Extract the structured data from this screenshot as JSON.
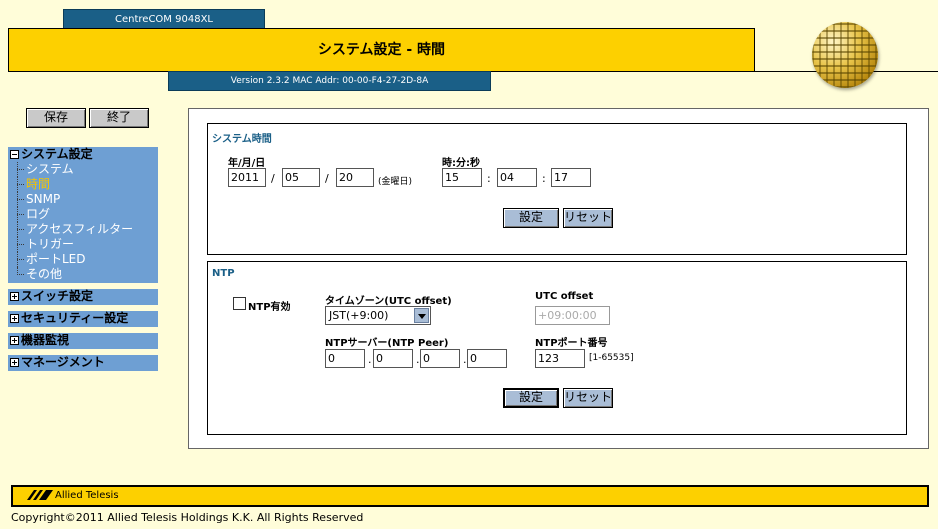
{
  "header": {
    "model": "CentreCOM 9048XL",
    "title": "システム設定 - 時間",
    "version": "Version 2.3.2 MAC Addr: 00-00-F4-27-2D-8A"
  },
  "toolbar": {
    "save_label": "保存",
    "exit_label": "終了"
  },
  "sidebar": {
    "system_group": {
      "label": "システム設定",
      "items": [
        "システム",
        "時間",
        "SNMP",
        "ログ",
        "アクセスフィルター",
        "トリガー",
        "ポートLED",
        "その他"
      ]
    },
    "switch_group": "スイッチ設定",
    "security_group": "セキュリティー設定",
    "monitor_group": "機器監視",
    "management_group": "マネージメント"
  },
  "system_time": {
    "title": "システム時間",
    "date_label": "年/月/日",
    "time_label": "時:分:秒",
    "year": "2011",
    "month": "05",
    "day": "20",
    "weekday": "(金曜日)",
    "hour": "15",
    "minute": "04",
    "second": "17",
    "date_sep": "/",
    "time_sep": ":",
    "set_label": "設定",
    "reset_label": "リセット"
  },
  "ntp": {
    "title": "NTP",
    "enable_label": "NTP有効",
    "enabled": false,
    "timezone_label": "タイムゾーン(UTC offset)",
    "timezone_value": "JST(+9:00)",
    "utc_offset_label": "UTC offset",
    "utc_offset_value": "+09:00:00",
    "server_label": "NTPサーバー(NTP Peer)",
    "server_ip": [
      "0",
      "0",
      "0",
      "0"
    ],
    "ip_sep": ".",
    "port_label": "NTPポート番号",
    "port_value": "123",
    "port_range": "[1-65535]",
    "set_label": "設定",
    "reset_label": "リセット"
  },
  "footer": {
    "brand": "Allied Telesis",
    "copyright": "Copyright©2011 Allied Telesis Holdings K.K. All Rights Reserved"
  }
}
